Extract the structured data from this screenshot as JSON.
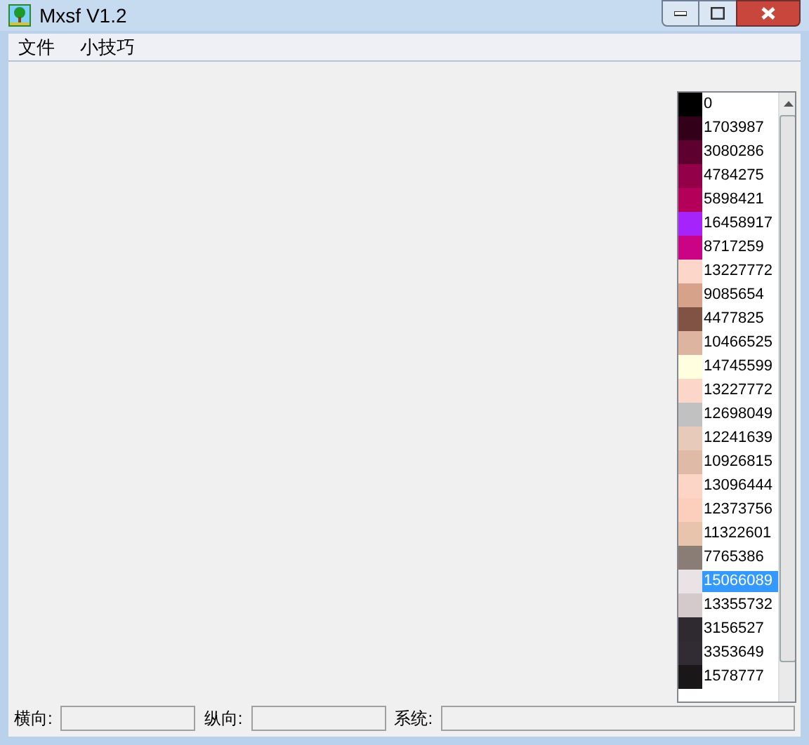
{
  "window": {
    "title": "Mxsf V1.2"
  },
  "menu": [
    "文件",
    "小技巧"
  ],
  "colors": [
    {
      "value": "0",
      "color": "#000000",
      "selected": false
    },
    {
      "value": "1703987",
      "color": "#33001a",
      "selected": false
    },
    {
      "value": "3080286",
      "color": "#5e002f",
      "selected": false
    },
    {
      "value": "4784275",
      "color": "#930049",
      "selected": false
    },
    {
      "value": "5898421",
      "color": "#b5005a",
      "selected": false
    },
    {
      "value": "16458917",
      "color": "#a524fb",
      "selected": false
    },
    {
      "value": "8717259",
      "color": "#cb0385",
      "selected": false
    },
    {
      "value": "13227772",
      "color": "#fcd6c9",
      "selected": false
    },
    {
      "value": "9085654",
      "color": "#d6a28a",
      "selected": false
    },
    {
      "value": "4477825",
      "color": "#815344",
      "selected": false
    },
    {
      "value": "10466525",
      "color": "#ddb49f",
      "selected": false
    },
    {
      "value": "14745599",
      "color": "#ffffe0",
      "selected": false
    },
    {
      "value": "13227772",
      "color": "#fcd6c9",
      "selected": false
    },
    {
      "value": "12698049",
      "color": "#c1c1c1",
      "selected": false
    },
    {
      "value": "12241639",
      "color": "#e7caba",
      "selected": false
    },
    {
      "value": "10926815",
      "color": "#dfbaa6",
      "selected": false
    },
    {
      "value": "13096444",
      "color": "#fcd5c7",
      "selected": false
    },
    {
      "value": "12373756",
      "color": "#fccebc",
      "selected": false
    },
    {
      "value": "11322601",
      "color": "#e9c4ac",
      "selected": false
    },
    {
      "value": "7765386",
      "color": "#8a7d76",
      "selected": false
    },
    {
      "value": "15066089",
      "color": "#e9e3e5",
      "selected": true
    },
    {
      "value": "13355732",
      "color": "#d4cacb",
      "selected": false
    },
    {
      "value": "3156527",
      "color": "#2f2a30",
      "selected": false
    },
    {
      "value": "3353649",
      "color": "#312c33",
      "selected": false
    },
    {
      "value": "1578777",
      "color": "#191718",
      "selected": false
    }
  ],
  "status": [
    {
      "label": "横向:"
    },
    {
      "label": "纵向:"
    },
    {
      "label": "系统:"
    }
  ]
}
